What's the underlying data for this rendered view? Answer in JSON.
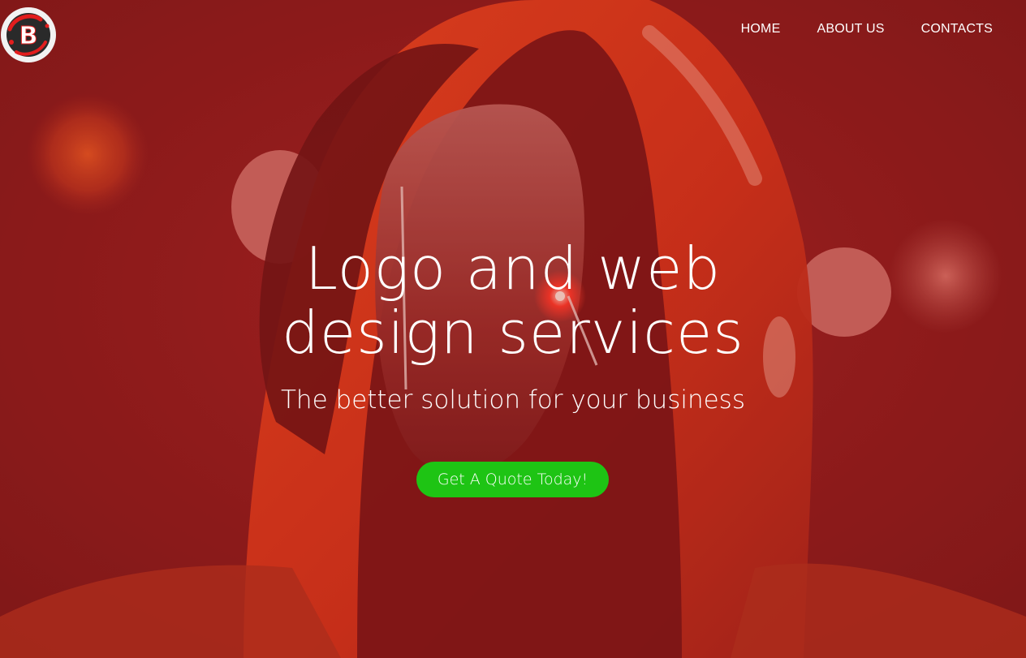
{
  "brand": {
    "logo_letter": "B",
    "logo_icon": "brand-logo-icon"
  },
  "nav": {
    "items": [
      {
        "label": "HOME"
      },
      {
        "label": "ABOUT US"
      },
      {
        "label": "CONTACTS"
      }
    ]
  },
  "hero": {
    "headline_line1": "Logo and web",
    "headline_line2": "design services",
    "subtitle": "The better solution for your business",
    "cta_label": "Get A Quote Today!"
  },
  "colors": {
    "background": "#8e1e1e",
    "accent_red": "#e8371c",
    "cta_green": "#1ec414",
    "text": "#ffffff"
  }
}
